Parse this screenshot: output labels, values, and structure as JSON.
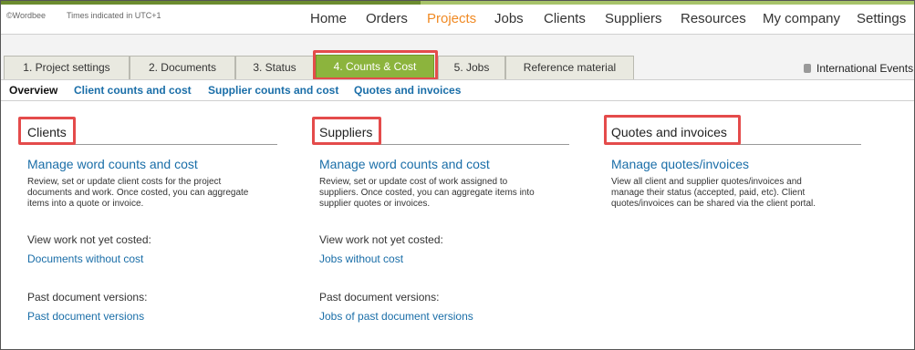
{
  "header": {
    "brand": "©Wordbee",
    "timezone": "Times indicated in UTC+1",
    "nav": [
      "Home",
      "Orders",
      "Projects",
      "Jobs",
      "Clients",
      "Suppliers",
      "Resources",
      "My company",
      "Settings"
    ],
    "active_nav": "Projects"
  },
  "tabs": [
    "1. Project settings",
    "2. Documents",
    "3. Status",
    "4. Counts & Cost",
    "5. Jobs",
    "Reference material"
  ],
  "active_tab": "4. Counts & Cost",
  "international_events": "International Events",
  "subnav": [
    "Overview",
    "Client counts and cost",
    "Supplier counts and cost",
    "Quotes and invoices"
  ],
  "active_subnav": "Overview",
  "columns": {
    "clients": {
      "title": "Clients",
      "link": "Manage word counts and cost",
      "desc": [
        "Review, set or update client costs for the project",
        "documents and work. Once costed, you can aggregate",
        "items into a quote or invoice."
      ],
      "label1": "View work not yet costed:",
      "link1": "Documents without cost",
      "label2": "Past document versions:",
      "link2": "Past document versions"
    },
    "suppliers": {
      "title": "Suppliers",
      "link": "Manage word counts and cost",
      "desc": [
        "Review, set or update cost of work assigned to",
        "suppliers. Once costed, you can aggregate items into",
        "supplier quotes or invoices."
      ],
      "label1": "View work not yet costed:",
      "link1": "Jobs without cost",
      "label2": "Past document versions:",
      "link2": "Jobs of past document versions"
    },
    "quotes": {
      "title": "Quotes and invoices",
      "link": "Manage quotes/invoices",
      "desc": [
        "View all client and supplier quotes/invoices and",
        "manage their status (accepted, paid, etc). Client",
        "quotes/invoices can be shared via the client portal."
      ]
    }
  },
  "colors": {
    "accent_green": "#8cb43d",
    "nav_active_orange": "#f08a24",
    "link_blue": "#1a6ea8",
    "highlight_red": "#e44b4b"
  }
}
